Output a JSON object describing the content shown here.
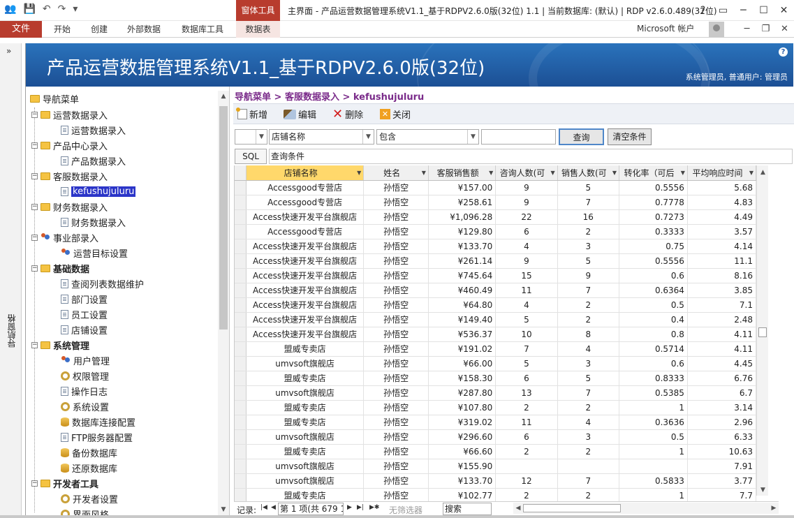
{
  "titlebar": {
    "tool_tab": "窗体工具",
    "title": "主界面 - 产品运营数据管理系统V1.1_基于RDPV2.6.0版(32位) 1.1 | 当前数据库: (默认) | RDP v2.6.0.489(32位)",
    "help": "?"
  },
  "ribbon": {
    "file": "文件",
    "tabs": [
      "开始",
      "创建",
      "外部数据",
      "数据库工具",
      "数据表"
    ],
    "account": "Microsoft 帐户"
  },
  "navpane": {
    "label": "导航窗格",
    "toggle": "»"
  },
  "banner": {
    "title": "产品运营数据管理系统V1.1_基于RDPV2.6.0版(32位)",
    "user": "系统管理员, 普通用户: 管理员",
    "help": "?"
  },
  "tree": {
    "root": "导航菜单",
    "items": [
      {
        "label": "运营数据录入",
        "level": 1,
        "icon": "folder-icon",
        "expander": "−"
      },
      {
        "label": "运营数据录入",
        "level": 2,
        "icon": "document-icon"
      },
      {
        "label": "产品中心录入",
        "level": 1,
        "icon": "folder-icon",
        "expander": "−"
      },
      {
        "label": "产品数据录入",
        "level": 2,
        "icon": "document-icon"
      },
      {
        "label": "客服数据录入",
        "level": 1,
        "icon": "folder-icon",
        "expander": "−"
      },
      {
        "label": "kefushujuluru",
        "level": 2,
        "icon": "document-icon",
        "selected": true
      },
      {
        "label": "财务数据录入",
        "level": 1,
        "icon": "folder-icon",
        "expander": "−"
      },
      {
        "label": "财务数据录入",
        "level": 2,
        "icon": "document-icon"
      },
      {
        "label": "事业部录入",
        "level": 1,
        "icon": "users-icon",
        "expander": "−"
      },
      {
        "label": "运营目标设置",
        "level": 2,
        "icon": "target-icon"
      },
      {
        "label": "基础数据",
        "level": 1,
        "icon": "folder-icon",
        "expander": "−",
        "bold": true
      },
      {
        "label": "查阅列表数据维护",
        "level": 2,
        "icon": "table-icon"
      },
      {
        "label": "部门设置",
        "level": 2,
        "icon": "document-icon"
      },
      {
        "label": "员工设置",
        "level": 2,
        "icon": "document-icon"
      },
      {
        "label": "店铺设置",
        "level": 2,
        "icon": "document-icon"
      },
      {
        "label": "系统管理",
        "level": 1,
        "icon": "folder-icon",
        "expander": "−",
        "bold": true
      },
      {
        "label": "用户管理",
        "level": 2,
        "icon": "users-icon"
      },
      {
        "label": "权限管理",
        "level": 2,
        "icon": "permission-icon"
      },
      {
        "label": "操作日志",
        "level": 2,
        "icon": "document-icon"
      },
      {
        "label": "系统设置",
        "level": 2,
        "icon": "settings-icon"
      },
      {
        "label": "数据库连接配置",
        "level": 2,
        "icon": "database-icon"
      },
      {
        "label": "FTP服务器配置",
        "level": 2,
        "icon": "document-icon"
      },
      {
        "label": "备份数据库",
        "level": 2,
        "icon": "database-icon"
      },
      {
        "label": "还原数据库",
        "level": 2,
        "icon": "database-icon"
      },
      {
        "label": "开发者工具",
        "level": 1,
        "icon": "folder-icon",
        "expander": "−",
        "bold": true
      },
      {
        "label": "开发者设置",
        "level": 2,
        "icon": "settings-icon"
      },
      {
        "label": "界面风格",
        "level": 2,
        "icon": "palette-icon"
      }
    ]
  },
  "breadcrumb": {
    "text": "导航菜单 > 客服数据录入 > kefushujuluru"
  },
  "toolbar": {
    "new": "新增",
    "edit": "编辑",
    "delete": "删除",
    "close": "关闭"
  },
  "filter": {
    "field": "店铺名称",
    "op": "包含",
    "query": "查询",
    "clear": "清空条件",
    "sql": "SQL",
    "sql_text": "查询条件"
  },
  "grid": {
    "columns": [
      "店铺名称",
      "姓名",
      "客服销售额",
      "咨询人数(可",
      "销售人数(可",
      "转化率（可后",
      "平均响应时间"
    ],
    "rows": [
      [
        "Accessgood专营店",
        "孙悟空",
        "¥157.00",
        "9",
        "5",
        "0.5556",
        "5.68"
      ],
      [
        "Accessgood专营店",
        "孙悟空",
        "¥258.61",
        "9",
        "7",
        "0.7778",
        "4.83"
      ],
      [
        "Access快速开发平台旗舰店",
        "孙悟空",
        "¥1,096.28",
        "22",
        "16",
        "0.7273",
        "4.49"
      ],
      [
        "Accessgood专营店",
        "孙悟空",
        "¥129.80",
        "6",
        "2",
        "0.3333",
        "3.57"
      ],
      [
        "Access快速开发平台旗舰店",
        "孙悟空",
        "¥133.70",
        "4",
        "3",
        "0.75",
        "4.14"
      ],
      [
        "Access快速开发平台旗舰店",
        "孙悟空",
        "¥261.14",
        "9",
        "5",
        "0.5556",
        "11.1"
      ],
      [
        "Access快速开发平台旗舰店",
        "孙悟空",
        "¥745.64",
        "15",
        "9",
        "0.6",
        "8.16"
      ],
      [
        "Access快速开发平台旗舰店",
        "孙悟空",
        "¥460.49",
        "11",
        "7",
        "0.6364",
        "3.85"
      ],
      [
        "Access快速开发平台旗舰店",
        "孙悟空",
        "¥64.80",
        "4",
        "2",
        "0.5",
        "7.1"
      ],
      [
        "Access快速开发平台旗舰店",
        "孙悟空",
        "¥149.40",
        "5",
        "2",
        "0.4",
        "2.48"
      ],
      [
        "Access快速开发平台旗舰店",
        "孙悟空",
        "¥536.37",
        "10",
        "8",
        "0.8",
        "4.11"
      ],
      [
        "盟威专卖店",
        "孙悟空",
        "¥191.02",
        "7",
        "4",
        "0.5714",
        "4.11"
      ],
      [
        "umvsoft旗舰店",
        "孙悟空",
        "¥66.00",
        "5",
        "3",
        "0.6",
        "4.45"
      ],
      [
        "盟威专卖店",
        "孙悟空",
        "¥158.30",
        "6",
        "5",
        "0.8333",
        "6.76"
      ],
      [
        "umvsoft旗舰店",
        "孙悟空",
        "¥287.80",
        "13",
        "7",
        "0.5385",
        "6.7"
      ],
      [
        "盟威专卖店",
        "孙悟空",
        "¥107.80",
        "2",
        "2",
        "1",
        "3.14"
      ],
      [
        "盟威专卖店",
        "孙悟空",
        "¥319.02",
        "11",
        "4",
        "0.3636",
        "2.96"
      ],
      [
        "umvsoft旗舰店",
        "孙悟空",
        "¥296.60",
        "6",
        "3",
        "0.5",
        "6.33"
      ],
      [
        "盟威专卖店",
        "孙悟空",
        "¥66.60",
        "2",
        "2",
        "1",
        "10.63"
      ],
      [
        "umvsoft旗舰店",
        "孙悟空",
        "¥155.90",
        "",
        "",
        "",
        "7.91"
      ],
      [
        "umvsoft旗舰店",
        "孙悟空",
        "¥133.70",
        "12",
        "7",
        "0.5833",
        "3.77"
      ],
      [
        "盟威专卖店",
        "孙悟空",
        "¥102.77",
        "2",
        "2",
        "1",
        "7.7"
      ]
    ]
  },
  "recordnav": {
    "label": "记录:",
    "record": "第 1 项(共 679 1",
    "nofilter": "无筛选器",
    "search": "搜索"
  }
}
